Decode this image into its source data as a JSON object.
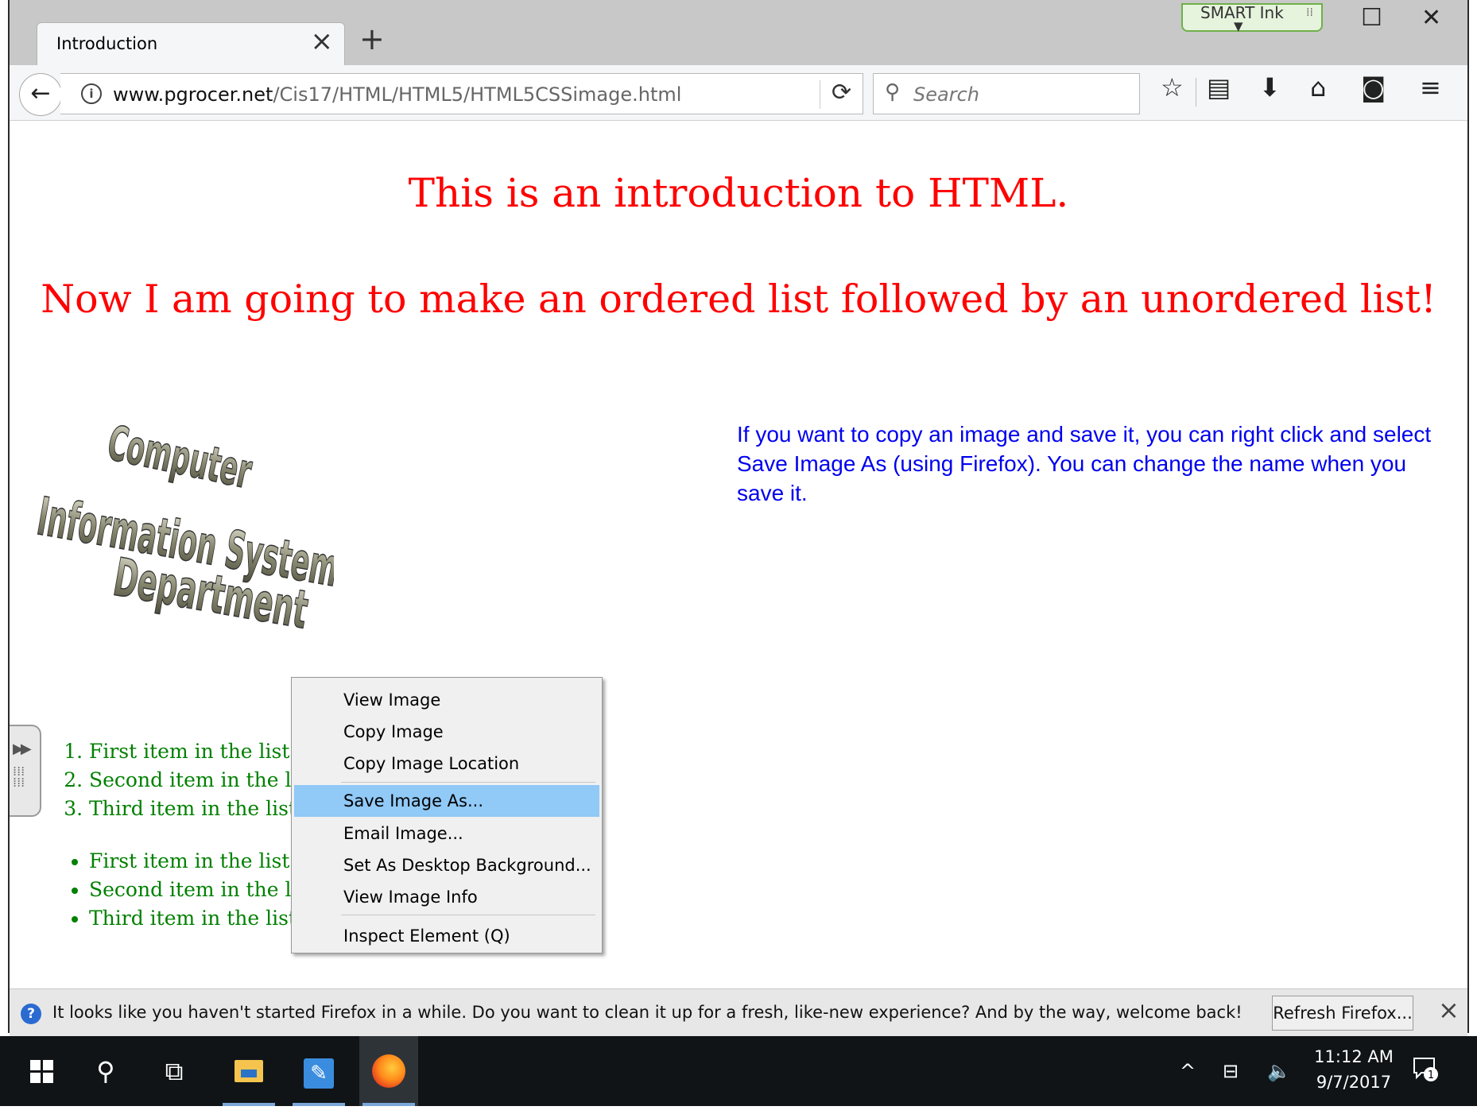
{
  "browser": {
    "tab_title": "Introduction",
    "tab_close_icon": "close-icon",
    "new_tab_symbol": "+",
    "url_domain": "www.pgrocer.net",
    "url_path": "/Cis17/HTML/HTML5/HTML5CSSimage.html",
    "search_placeholder": "Search",
    "smart_ink_label": "SMART Ink"
  },
  "page": {
    "heading1": "This is an introduction to HTML.",
    "heading2": "Now I am going to make an ordered list followed by an unordered list!",
    "info_text": "If you want to copy an image and save it, you can right click and select Save Image As (using Firefox). You can change the name when you save it.",
    "logo_lines": [
      "Computer",
      "Information Systems",
      "Department"
    ],
    "ordered_list": [
      "First item in the list",
      "Second item in the list",
      "Third item in the list"
    ],
    "unordered_list": [
      "First item in the list",
      "Second item in the list",
      "Third item in the list"
    ]
  },
  "context_menu": {
    "items": [
      {
        "label": "View Image",
        "highlighted": false
      },
      {
        "label": "Copy Image",
        "highlighted": false
      },
      {
        "label": "Copy Image Location",
        "highlighted": false
      },
      {
        "label": "Save Image As...",
        "highlighted": true
      },
      {
        "label": "Email Image...",
        "highlighted": false
      },
      {
        "label": "Set As Desktop Background...",
        "highlighted": false
      },
      {
        "label": "View Image Info",
        "highlighted": false
      },
      {
        "label": "Inspect Element (Q)",
        "highlighted": false
      }
    ]
  },
  "notification": {
    "message": "It looks like you haven't started Firefox in a while. Do you want to clean it up for a fresh, like-new experience? And by the way, welcome back!",
    "button_label": "Refresh Firefox..."
  },
  "taskbar": {
    "time": "11:12 AM",
    "date": "9/7/2017",
    "notification_count": "1"
  },
  "colors": {
    "heading": "#ff0000",
    "info_text": "#0000ee",
    "list_text": "#008000",
    "menu_highlight": "#91c9f7"
  }
}
